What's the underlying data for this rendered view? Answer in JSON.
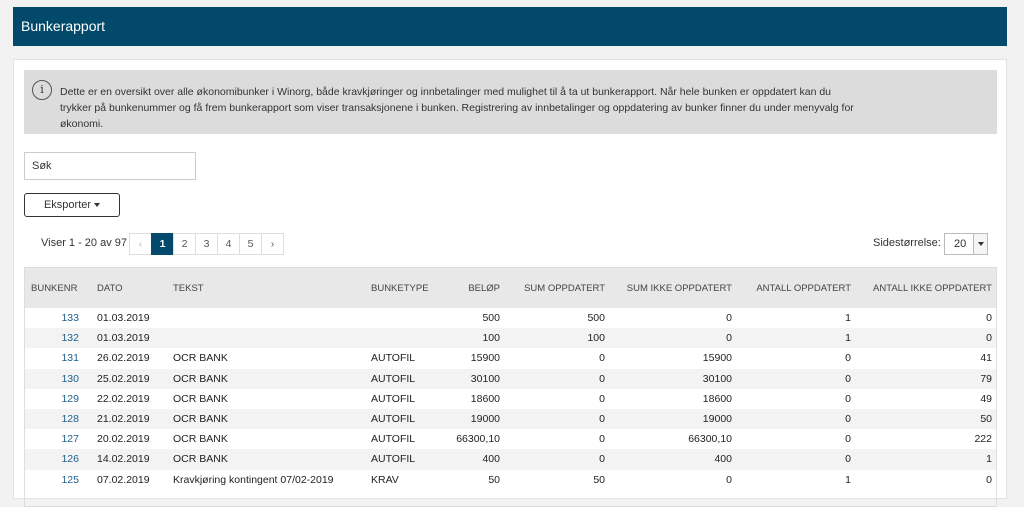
{
  "header": {
    "title": "Bunkerapport"
  },
  "info": {
    "icon": "info-icon",
    "icon_glyph": "i",
    "text": "Dette er en oversikt over alle økonomibunker i Winorg, både kravkjøringer og innbetalinger med mulighet til å ta ut bunkerapport. Når hele bunken er oppdatert kan du trykker på bunkenummer og få frem bunkerapport som viser transaksjonene i bunken. Registrering av innbetalinger og oppdatering av bunker finner du under menyvalg for økonomi."
  },
  "search": {
    "value": "Søk"
  },
  "toolbar": {
    "export_label": "Eksporter"
  },
  "pagination": {
    "showing": "Viser 1 - 20 av 97",
    "prev": "‹",
    "next": "›",
    "pages": [
      "1",
      "2",
      "3",
      "4",
      "5"
    ],
    "active": "1",
    "page_size_label": "Sidestørrelse:",
    "page_size": "20"
  },
  "table": {
    "columns": [
      "BUNKENR",
      "DATO",
      "TEKST",
      "BUNKETYPE",
      "BELØP",
      "SUM OPPDATERT",
      "SUM IKKE OPPDATERT",
      "ANTALL OPPDATERT",
      "ANTALL IKKE OPPDATERT"
    ],
    "rows": [
      [
        "133",
        "01.03.2019",
        "",
        "",
        "500",
        "500",
        "0",
        "1",
        "0"
      ],
      [
        "132",
        "01.03.2019",
        "",
        "",
        "100",
        "100",
        "0",
        "1",
        "0"
      ],
      [
        "131",
        "26.02.2019",
        "OCR BANK",
        "AUTOFIL",
        "15900",
        "0",
        "15900",
        "0",
        "41"
      ],
      [
        "130",
        "25.02.2019",
        "OCR BANK",
        "AUTOFIL",
        "30100",
        "0",
        "30100",
        "0",
        "79"
      ],
      [
        "129",
        "22.02.2019",
        "OCR BANK",
        "AUTOFIL",
        "18600",
        "0",
        "18600",
        "0",
        "49"
      ],
      [
        "128",
        "21.02.2019",
        "OCR BANK",
        "AUTOFIL",
        "19000",
        "0",
        "19000",
        "0",
        "50"
      ],
      [
        "127",
        "20.02.2019",
        "OCR BANK",
        "AUTOFIL",
        "66300,10",
        "0",
        "66300,10",
        "0",
        "222"
      ],
      [
        "126",
        "14.02.2019",
        "OCR BANK",
        "AUTOFIL",
        "400",
        "0",
        "400",
        "0",
        "1"
      ],
      [
        "125",
        "07.02.2019",
        "Kravkjøring kontingent 07/02-2019",
        "KRAV",
        "50",
        "50",
        "0",
        "1",
        "0"
      ]
    ]
  }
}
